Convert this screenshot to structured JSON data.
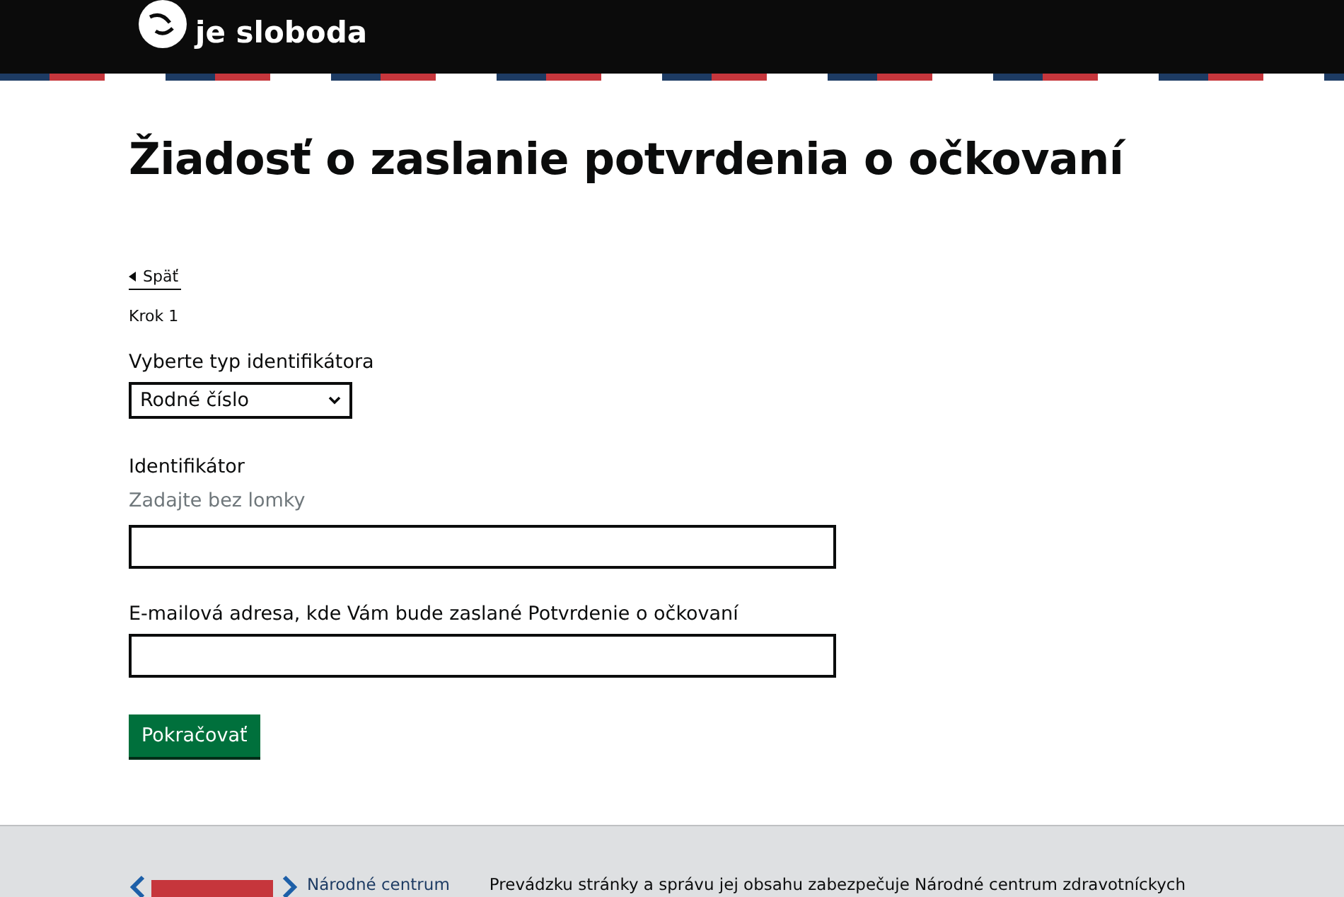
{
  "header": {
    "logo_text": "je sloboda"
  },
  "title": "Žiadosť o zaslanie potvrdenia o očkovaní",
  "back_link": "Späť",
  "step": "Krok 1",
  "id_type": {
    "label": "Vyberte typ identifikátora",
    "value": "Rodné číslo"
  },
  "identifier": {
    "label": "Identifikátor",
    "hint": "Zadajte bez lomky"
  },
  "email": {
    "label": "E-mailová adresa, kde Vám bude zaslané Potvrdenie o očkovaní"
  },
  "submit": "Pokračovať",
  "footer": {
    "org": "Národné centrum",
    "text": "Prevádzku stránky a správu jej obsahu zabezpečuje Národné centrum zdravotníckych"
  }
}
